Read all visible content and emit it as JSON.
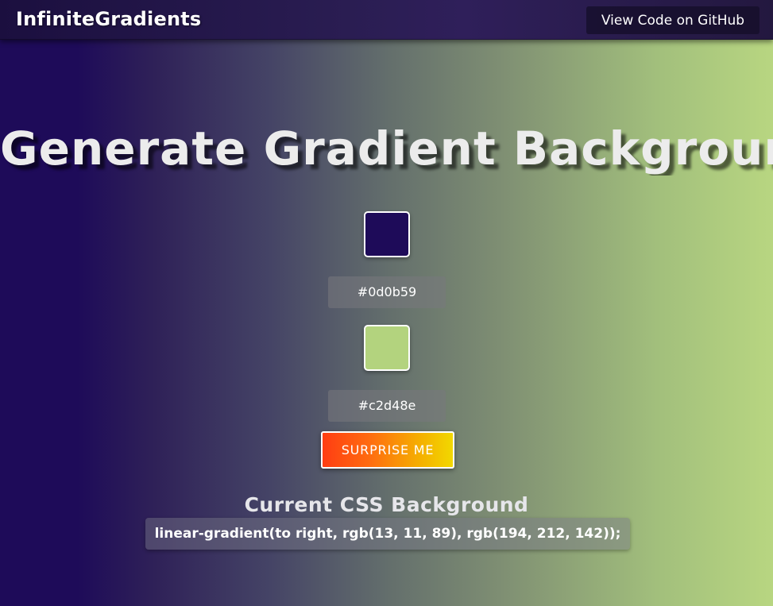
{
  "navbar": {
    "brand": "InfiniteGradients",
    "github_label": "View Code on GitHub"
  },
  "hero": {
    "title": "Generate Gradient Background"
  },
  "colors": {
    "first": {
      "swatch": "#1e0b59",
      "hex_value": "#0d0b59"
    },
    "second": {
      "swatch": "#b3d37e",
      "hex_value": "#c2d48e"
    }
  },
  "surprise_button": {
    "label": "SURPRISE ME"
  },
  "css_output": {
    "heading": "Current CSS Background",
    "value": "linear-gradient(to right, rgb(13, 11, 89), rgb(194, 212, 142));"
  }
}
